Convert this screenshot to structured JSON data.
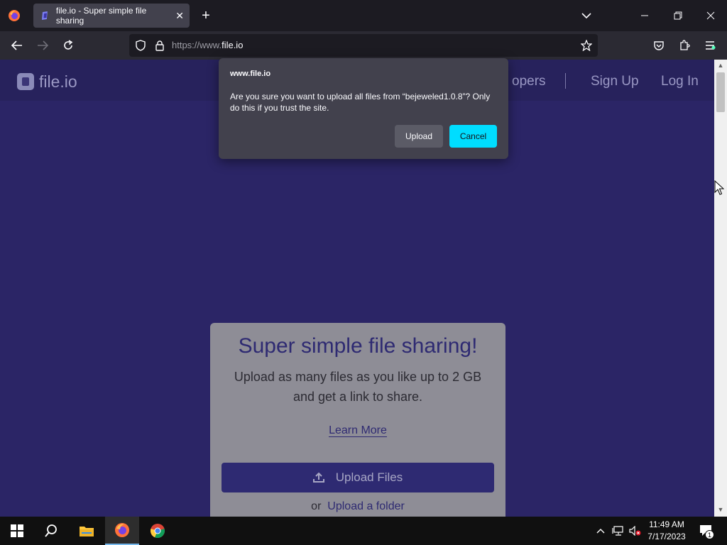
{
  "browser": {
    "tab_title": "file.io - Super simple file sharing",
    "url_prefix": "https://www.",
    "url_domain": "file.io"
  },
  "site": {
    "logo_text": "file.io",
    "nav": {
      "developers_partial": "opers",
      "signup": "Sign Up",
      "login": "Log In"
    },
    "card": {
      "title": "Super simple file sharing!",
      "subtitle_line1": "Upload as many files as you like up to 2 GB",
      "subtitle_line2": "and get a link to share.",
      "learn_more": "Learn More",
      "upload_files": "Upload Files",
      "or": "or",
      "upload_folder": "Upload a folder"
    }
  },
  "dialog": {
    "origin": "www.file.io",
    "message": "Are you sure you want to upload all files from “bejeweled1.0.8”? Only do this if you trust the site.",
    "upload_label": "Upload",
    "cancel_label": "Cancel"
  },
  "taskbar": {
    "time": "11:49 AM",
    "date": "7/17/2023",
    "notification_count": "1"
  },
  "colors": {
    "page_bg": "#2b2566",
    "accent_cancel": "#00ddff",
    "brand_dark": "#2e2a72"
  }
}
